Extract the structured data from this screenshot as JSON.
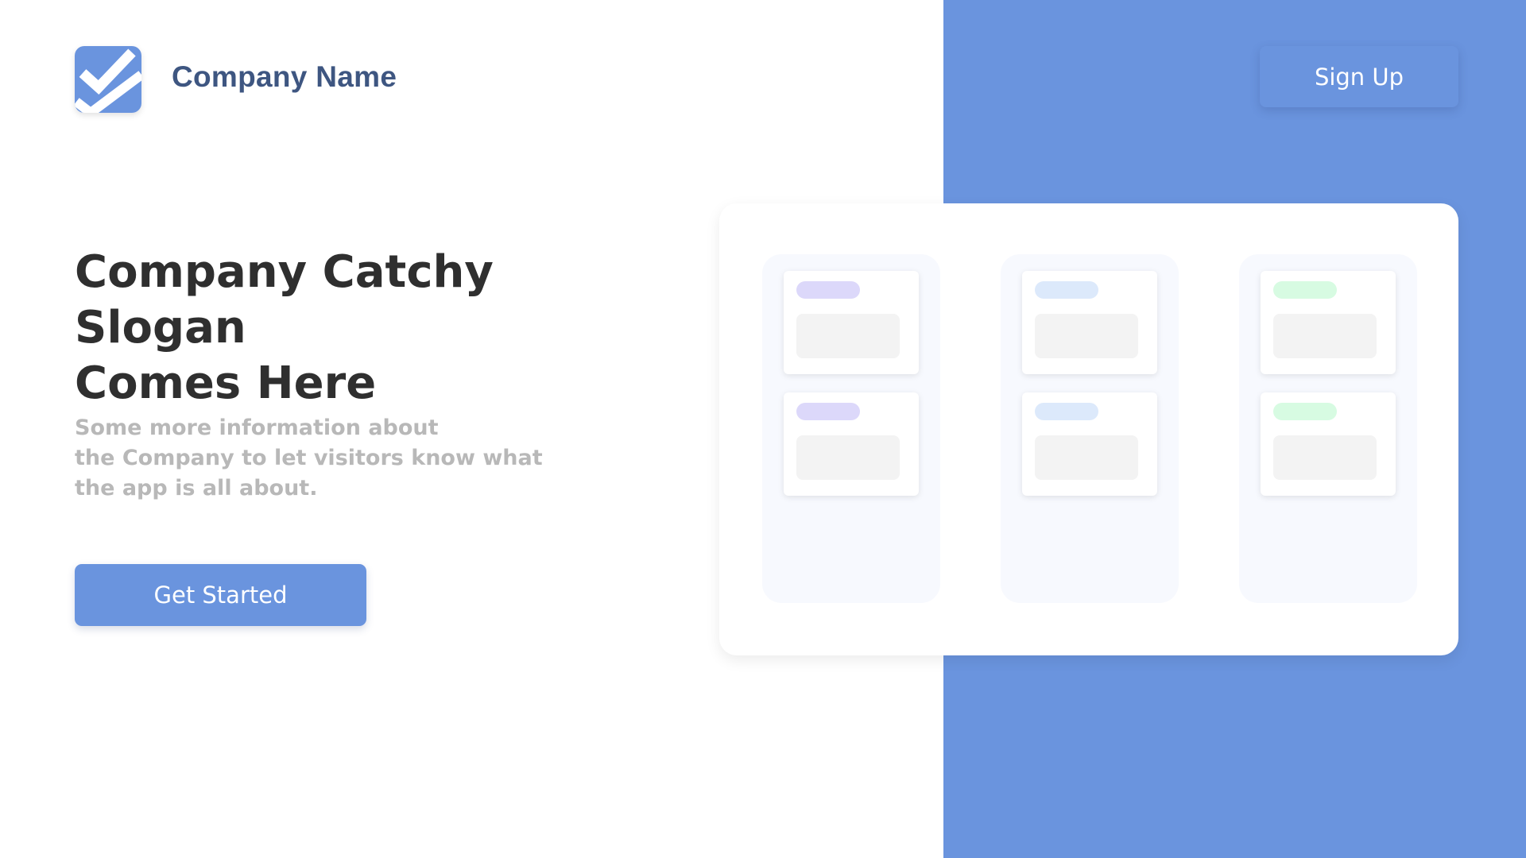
{
  "header": {
    "logo_icon": "checkmark-logo-icon",
    "company_name": "Company Name",
    "signup_label": "Sign Up"
  },
  "hero": {
    "slogan_lines": [
      "Company Catchy Slogan",
      "Comes Here"
    ],
    "info_lines": [
      "Some more information about",
      "the Company to let visitors know what",
      "the app is all about."
    ],
    "cta_label": "Get Started"
  },
  "board": {
    "columns": [
      {
        "accent": "#dcd8fa",
        "cards": 2
      },
      {
        "accent": "#dce9fb",
        "cards": 2
      },
      {
        "accent": "#d7fbe2",
        "cards": 2
      }
    ]
  },
  "colors": {
    "brand": "#6a94de",
    "heading": "#2f2f2f",
    "company_name": "#3e5681",
    "muted_text": "#b8b8b8"
  }
}
